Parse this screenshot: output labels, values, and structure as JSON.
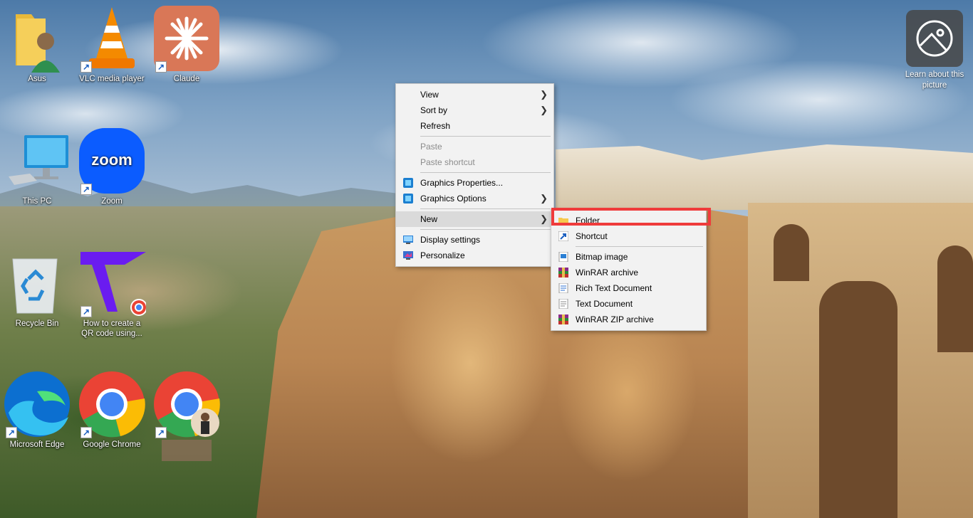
{
  "desktop": {
    "icons": [
      {
        "label": "Asus",
        "icon": "user-folder-icon"
      },
      {
        "label": "VLC media player",
        "icon": "vlc-icon"
      },
      {
        "label": "Claude",
        "icon": "claude-icon"
      },
      {
        "label": "This PC",
        "icon": "computer-icon"
      },
      {
        "label": "Zoom",
        "icon": "zoom-icon",
        "logo_text": "zoom"
      },
      {
        "label": "Recycle Bin",
        "icon": "recycle-bin-icon"
      },
      {
        "label": "How to create a QR code using...",
        "icon": "video-link-icon"
      },
      {
        "label": "Microsoft Edge",
        "icon": "edge-icon"
      },
      {
        "label": "Google Chrome",
        "icon": "chrome-icon"
      },
      {
        "label": "",
        "icon": "chrome-profile-icon"
      }
    ],
    "learn_about_picture": "Learn about this picture"
  },
  "context_menu": {
    "items": [
      {
        "label": "View",
        "submenu": true,
        "enabled": true
      },
      {
        "label": "Sort by",
        "submenu": true,
        "enabled": true
      },
      {
        "label": "Refresh",
        "enabled": true
      },
      {
        "label": "Paste",
        "enabled": false
      },
      {
        "label": "Paste shortcut",
        "enabled": false
      },
      {
        "label": "Graphics Properties...",
        "enabled": true,
        "icon": "intel-graphics-icon"
      },
      {
        "label": "Graphics Options",
        "submenu": true,
        "enabled": true,
        "icon": "intel-graphics-icon"
      },
      {
        "label": "New",
        "submenu": true,
        "enabled": true,
        "state": "hovered"
      },
      {
        "label": "Display settings",
        "enabled": true,
        "icon": "display-icon"
      },
      {
        "label": "Personalize",
        "enabled": true,
        "icon": "personalize-icon"
      }
    ]
  },
  "new_submenu": {
    "items": [
      {
        "label": "Folder",
        "icon": "folder-icon",
        "highlighted": true
      },
      {
        "label": "Shortcut",
        "icon": "shortcut-icon"
      },
      {
        "label": "Bitmap image",
        "icon": "bitmap-icon"
      },
      {
        "label": "WinRAR archive",
        "icon": "winrar-icon"
      },
      {
        "label": "Rich Text Document",
        "icon": "rtf-icon"
      },
      {
        "label": "Text Document",
        "icon": "text-document-icon"
      },
      {
        "label": "WinRAR ZIP archive",
        "icon": "winrar-zip-icon"
      }
    ]
  },
  "colors": {
    "menu_bg": "#f2f2f2",
    "menu_hover": "#dadada",
    "highlight_box": "#ef3b3b"
  }
}
